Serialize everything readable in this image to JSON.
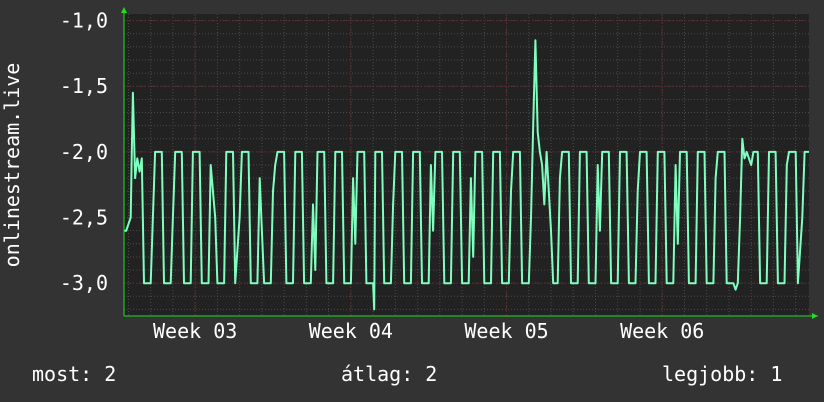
{
  "colors": {
    "background": "#333333",
    "plot_background": "#222222",
    "grid_major": "#5a2a2a",
    "grid_minor": "#4a4a4a",
    "axis_arrow": "#22dd22",
    "series_line": "#7fffbf",
    "text": "#ffffff"
  },
  "chart_data": {
    "type": "line",
    "ylabel": "onlinestream.live",
    "yticks": [
      {
        "value": -1.0,
        "label": "-1,0"
      },
      {
        "value": -1.5,
        "label": "-1,5"
      },
      {
        "value": -2.0,
        "label": "-2,0"
      },
      {
        "value": -2.5,
        "label": "-2,5"
      },
      {
        "value": -3.0,
        "label": "-3,0"
      }
    ],
    "ylim": [
      -3.25,
      -0.95
    ],
    "xticks": [
      {
        "value": 23,
        "label": "Week 03"
      },
      {
        "value": 30,
        "label": "Week 04"
      },
      {
        "value": 37,
        "label": "Week 05"
      },
      {
        "value": 44,
        "label": "Week 06"
      }
    ],
    "xlim": [
      19.8,
      50.6
    ],
    "grid": true,
    "legend": "none",
    "series": [
      {
        "values": [
          [
            19.8,
            -2.6
          ],
          [
            19.9,
            -2.6
          ],
          [
            20.1,
            -2.5
          ],
          [
            20.15,
            -2.0
          ],
          [
            20.2,
            -1.55
          ],
          [
            20.3,
            -2.2
          ],
          [
            20.4,
            -2.05
          ],
          [
            20.5,
            -2.15
          ],
          [
            20.6,
            -2.05
          ],
          [
            20.7,
            -3.0
          ],
          [
            21.0,
            -3.0
          ],
          [
            21.1,
            -2.5
          ],
          [
            21.2,
            -2.0
          ],
          [
            21.5,
            -2.0
          ],
          [
            21.6,
            -3.0
          ],
          [
            21.9,
            -3.0
          ],
          [
            22.0,
            -2.5
          ],
          [
            22.1,
            -2.0
          ],
          [
            22.4,
            -2.0
          ],
          [
            22.5,
            -3.0
          ],
          [
            22.8,
            -3.0
          ],
          [
            22.9,
            -2.0
          ],
          [
            23.2,
            -2.0
          ],
          [
            23.3,
            -3.0
          ],
          [
            23.6,
            -3.0
          ],
          [
            23.7,
            -2.1
          ],
          [
            23.9,
            -2.5
          ],
          [
            24.0,
            -3.0
          ],
          [
            24.3,
            -3.0
          ],
          [
            24.4,
            -2.0
          ],
          [
            24.7,
            -2.0
          ],
          [
            24.8,
            -3.0
          ],
          [
            25.0,
            -2.5
          ],
          [
            25.1,
            -2.0
          ],
          [
            25.4,
            -2.0
          ],
          [
            25.5,
            -3.0
          ],
          [
            25.8,
            -3.0
          ],
          [
            25.9,
            -2.2
          ],
          [
            26.0,
            -2.6
          ],
          [
            26.1,
            -3.0
          ],
          [
            26.4,
            -3.0
          ],
          [
            26.5,
            -2.3
          ],
          [
            26.6,
            -2.1
          ],
          [
            26.7,
            -2.0
          ],
          [
            27.0,
            -2.0
          ],
          [
            27.1,
            -3.0
          ],
          [
            27.4,
            -3.0
          ],
          [
            27.5,
            -2.0
          ],
          [
            27.8,
            -2.0
          ],
          [
            27.9,
            -3.0
          ],
          [
            28.2,
            -3.0
          ],
          [
            28.3,
            -2.4
          ],
          [
            28.4,
            -2.9
          ],
          [
            28.5,
            -2.0
          ],
          [
            28.8,
            -2.0
          ],
          [
            28.9,
            -3.0
          ],
          [
            29.2,
            -3.0
          ],
          [
            29.3,
            -2.0
          ],
          [
            29.6,
            -2.0
          ],
          [
            29.7,
            -3.0
          ],
          [
            30.0,
            -3.0
          ],
          [
            30.1,
            -2.2
          ],
          [
            30.2,
            -2.7
          ],
          [
            30.3,
            -2.0
          ],
          [
            30.6,
            -2.0
          ],
          [
            30.7,
            -3.0
          ],
          [
            31.0,
            -3.0
          ],
          [
            31.05,
            -3.2
          ],
          [
            31.1,
            -2.0
          ],
          [
            31.4,
            -2.0
          ],
          [
            31.5,
            -3.0
          ],
          [
            31.8,
            -3.0
          ],
          [
            31.9,
            -2.4
          ],
          [
            32.0,
            -2.0
          ],
          [
            32.3,
            -2.0
          ],
          [
            32.4,
            -3.0
          ],
          [
            32.7,
            -3.0
          ],
          [
            32.8,
            -2.0
          ],
          [
            33.1,
            -2.0
          ],
          [
            33.2,
            -3.0
          ],
          [
            33.5,
            -3.0
          ],
          [
            33.6,
            -2.1
          ],
          [
            33.7,
            -2.6
          ],
          [
            33.8,
            -2.0
          ],
          [
            34.1,
            -2.0
          ],
          [
            34.2,
            -3.0
          ],
          [
            34.5,
            -3.0
          ],
          [
            34.6,
            -2.0
          ],
          [
            34.9,
            -2.0
          ],
          [
            35.0,
            -3.0
          ],
          [
            35.3,
            -3.0
          ],
          [
            35.4,
            -2.2
          ],
          [
            35.5,
            -2.8
          ],
          [
            35.6,
            -2.0
          ],
          [
            35.9,
            -2.0
          ],
          [
            36.0,
            -3.0
          ],
          [
            36.3,
            -3.0
          ],
          [
            36.4,
            -2.0
          ],
          [
            36.7,
            -2.0
          ],
          [
            36.8,
            -3.0
          ],
          [
            37.1,
            -3.0
          ],
          [
            37.2,
            -2.3
          ],
          [
            37.3,
            -2.0
          ],
          [
            37.6,
            -2.0
          ],
          [
            37.7,
            -3.0
          ],
          [
            38.0,
            -3.0
          ],
          [
            38.1,
            -2.5
          ],
          [
            38.2,
            -1.8
          ],
          [
            38.3,
            -1.15
          ],
          [
            38.4,
            -1.85
          ],
          [
            38.5,
            -2.0
          ],
          [
            38.6,
            -2.1
          ],
          [
            38.7,
            -2.4
          ],
          [
            38.8,
            -2.0
          ],
          [
            39.0,
            -2.6
          ],
          [
            39.1,
            -3.0
          ],
          [
            39.3,
            -3.0
          ],
          [
            39.4,
            -2.2
          ],
          [
            39.5,
            -2.0
          ],
          [
            39.8,
            -2.0
          ],
          [
            39.9,
            -3.0
          ],
          [
            40.2,
            -3.0
          ],
          [
            40.3,
            -2.0
          ],
          [
            40.6,
            -2.0
          ],
          [
            40.7,
            -3.0
          ],
          [
            41.0,
            -3.0
          ],
          [
            41.1,
            -2.1
          ],
          [
            41.2,
            -2.6
          ],
          [
            41.3,
            -2.0
          ],
          [
            41.6,
            -2.0
          ],
          [
            41.7,
            -3.0
          ],
          [
            42.0,
            -3.0
          ],
          [
            42.1,
            -2.0
          ],
          [
            42.4,
            -2.0
          ],
          [
            42.5,
            -3.0
          ],
          [
            42.8,
            -3.0
          ],
          [
            42.9,
            -2.3
          ],
          [
            43.0,
            -2.0
          ],
          [
            43.3,
            -2.0
          ],
          [
            43.4,
            -3.0
          ],
          [
            43.7,
            -3.0
          ],
          [
            43.8,
            -2.0
          ],
          [
            44.1,
            -2.0
          ],
          [
            44.2,
            -3.0
          ],
          [
            44.5,
            -3.0
          ],
          [
            44.6,
            -2.1
          ],
          [
            44.7,
            -2.7
          ],
          [
            44.8,
            -2.0
          ],
          [
            45.1,
            -2.0
          ],
          [
            45.2,
            -3.0
          ],
          [
            45.5,
            -3.0
          ],
          [
            45.6,
            -2.0
          ],
          [
            45.9,
            -2.0
          ],
          [
            46.0,
            -3.0
          ],
          [
            46.3,
            -3.0
          ],
          [
            46.4,
            -2.2
          ],
          [
            46.5,
            -2.0
          ],
          [
            46.8,
            -2.0
          ],
          [
            46.9,
            -3.0
          ],
          [
            47.2,
            -3.0
          ],
          [
            47.3,
            -3.05
          ],
          [
            47.4,
            -3.0
          ],
          [
            47.5,
            -2.5
          ],
          [
            47.6,
            -1.9
          ],
          [
            47.7,
            -2.05
          ],
          [
            47.8,
            -2.0
          ],
          [
            48.0,
            -2.1
          ],
          [
            48.1,
            -2.0
          ],
          [
            48.3,
            -2.0
          ],
          [
            48.4,
            -3.0
          ],
          [
            48.7,
            -3.0
          ],
          [
            48.8,
            -2.0
          ],
          [
            49.1,
            -2.0
          ],
          [
            49.2,
            -3.0
          ],
          [
            49.5,
            -3.0
          ],
          [
            49.6,
            -2.1
          ],
          [
            49.7,
            -2.0
          ],
          [
            50.0,
            -2.0
          ],
          [
            50.1,
            -3.0
          ],
          [
            50.3,
            -2.5
          ],
          [
            50.4,
            -2.0
          ],
          [
            50.6,
            -2.0
          ]
        ]
      }
    ]
  },
  "footer": {
    "current": "most: 2",
    "average": "átlag: 2",
    "best": "legjobb: 1"
  }
}
